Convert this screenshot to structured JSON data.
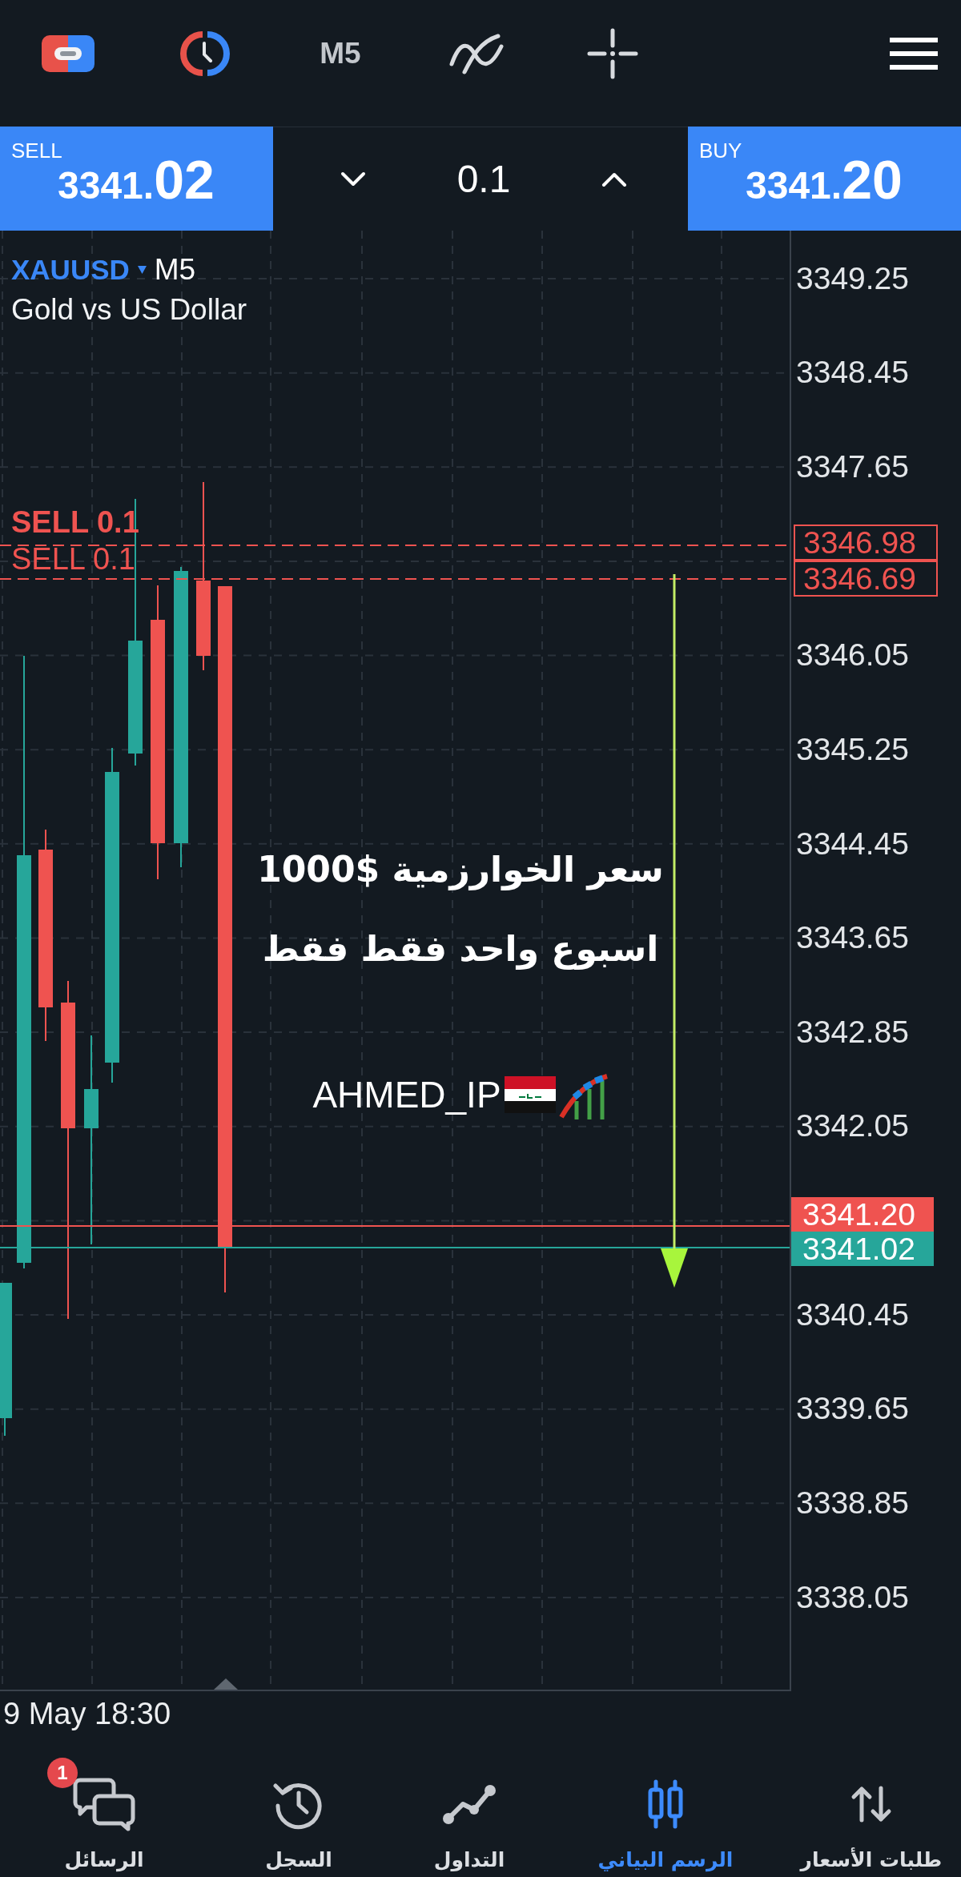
{
  "toolbar": {
    "timeframe": "M5"
  },
  "trade_bar": {
    "sell": {
      "label": "SELL",
      "price_head": "3341.",
      "price_tail": "02"
    },
    "volume": "0.1",
    "buy": {
      "label": "BUY",
      "price_head": "3341.",
      "price_tail": "20"
    }
  },
  "chart": {
    "symbol": "XAUUSD",
    "timeframe": "M5",
    "description": "Gold vs US Dollar",
    "orders": [
      {
        "label": "SELL 0.1",
        "price": "3346.98"
      },
      {
        "label": "SELL 0.1",
        "price": "3346.69"
      }
    ],
    "caption": [
      "سعر الخوارزمية $1000",
      "اسبوع واحد فقط فقط"
    ],
    "signature": "AHMED_IP",
    "price_axis": [
      "3349.25",
      "3348.45",
      "3347.65",
      "3346.05",
      "3345.25",
      "3344.45",
      "3343.65",
      "3342.85",
      "3342.05",
      "3340.45",
      "3339.65",
      "3338.85",
      "3338.05"
    ],
    "ask_price": "3341.20",
    "bid_price": "3341.02",
    "time_label": "9 May 18:30"
  },
  "bottom_nav": [
    {
      "kind": "quotes",
      "label": "طلبات الأسعار",
      "selected": false
    },
    {
      "kind": "chart",
      "label": "الرسم البياني",
      "selected": true
    },
    {
      "kind": "trade",
      "label": "التداول",
      "selected": false
    },
    {
      "kind": "history",
      "label": "السجل",
      "selected": false
    },
    {
      "kind": "messages",
      "label": "الرسائل",
      "selected": false,
      "badge": "1"
    }
  ]
}
